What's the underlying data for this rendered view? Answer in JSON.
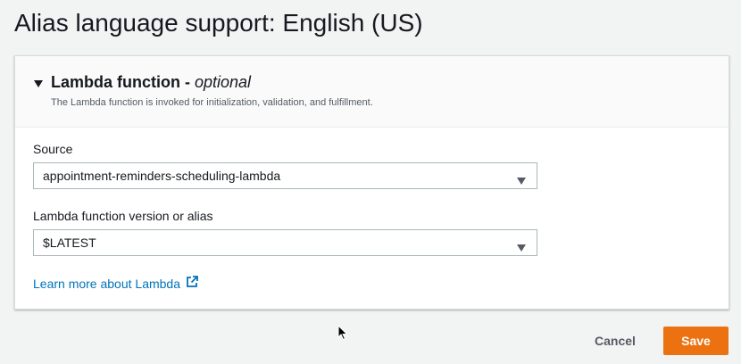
{
  "page": {
    "title": "Alias language support: English (US)"
  },
  "lambda_section": {
    "title": "Lambda function - ",
    "optional_label": "optional",
    "description": "The Lambda function is invoked for initialization, validation, and fulfillment.",
    "expanded": true
  },
  "source_field": {
    "label": "Source",
    "value": "appointment-reminders-scheduling-lambda"
  },
  "version_field": {
    "label": "Lambda function version or alias",
    "value": "$LATEST"
  },
  "learn_more": {
    "label": "Learn more about Lambda",
    "icon": "external-link-icon"
  },
  "footer": {
    "cancel_label": "Cancel",
    "save_label": "Save"
  },
  "colors": {
    "accent": "#ec7211",
    "link": "#0073bb"
  }
}
